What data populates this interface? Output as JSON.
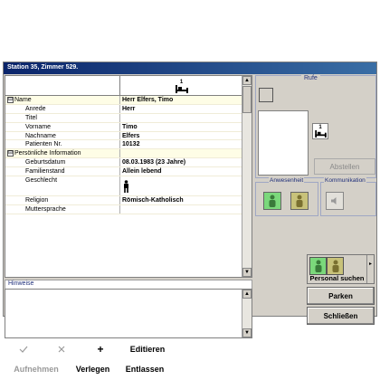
{
  "window": {
    "title": "Station 35, Zimmer 529."
  },
  "table": {
    "bed_number": "1",
    "rows": [
      {
        "key": "Name",
        "value": "Herr Elfers, Timo",
        "type": "section",
        "expander": "⊟"
      },
      {
        "key": "Anrede",
        "value": "Herr",
        "type": "child"
      },
      {
        "key": "Titel",
        "value": "",
        "type": "child"
      },
      {
        "key": "Vorname",
        "value": "Timo",
        "type": "child"
      },
      {
        "key": "Nachname",
        "value": "Elfers",
        "type": "child"
      },
      {
        "key": "Patienten Nr.",
        "value": "10132",
        "type": "child"
      },
      {
        "key": "Persönliche Information",
        "value": "",
        "type": "section",
        "expander": "⊟"
      },
      {
        "key": "Geburtsdatum",
        "value": "08.03.1983 (23 Jahre)",
        "type": "child"
      },
      {
        "key": "Familienstand",
        "value": "Allein lebend",
        "type": "child"
      },
      {
        "key": "Geschlecht",
        "value": "",
        "type": "child-tall",
        "icon": "male-icon"
      },
      {
        "key": "Religion",
        "value": "Römisch-Katholisch",
        "type": "child"
      },
      {
        "key": "Muttersprache",
        "value": "",
        "type": "child"
      }
    ]
  },
  "hints": {
    "label": "Hinweise"
  },
  "toolbar": {
    "check_icon": "check-icon",
    "delete_icon": "x-icon",
    "add_symbol": "+",
    "edit_label": "Editieren",
    "admit_label": "Aufnehmen",
    "transfer_label": "Verlegen",
    "discharge_label": "Entlassen"
  },
  "right": {
    "calls_label": "Rufe",
    "bed_number": "1",
    "abstellen_label": "Abstellen",
    "presence_label": "Anwesenheit",
    "communication_label": "Kommunikation",
    "personal_search_label": "Personal suchen",
    "park_label": "Parken",
    "close_label": "Schließen"
  },
  "colors": {
    "titlebar_start": "#0a246a",
    "titlebar_end": "#3a6ea5",
    "highlight_row": "#fefde6",
    "presence_green": "#7bd87b",
    "presence_yellow": "#c8c27a",
    "group_label": "#1f2f7a"
  }
}
